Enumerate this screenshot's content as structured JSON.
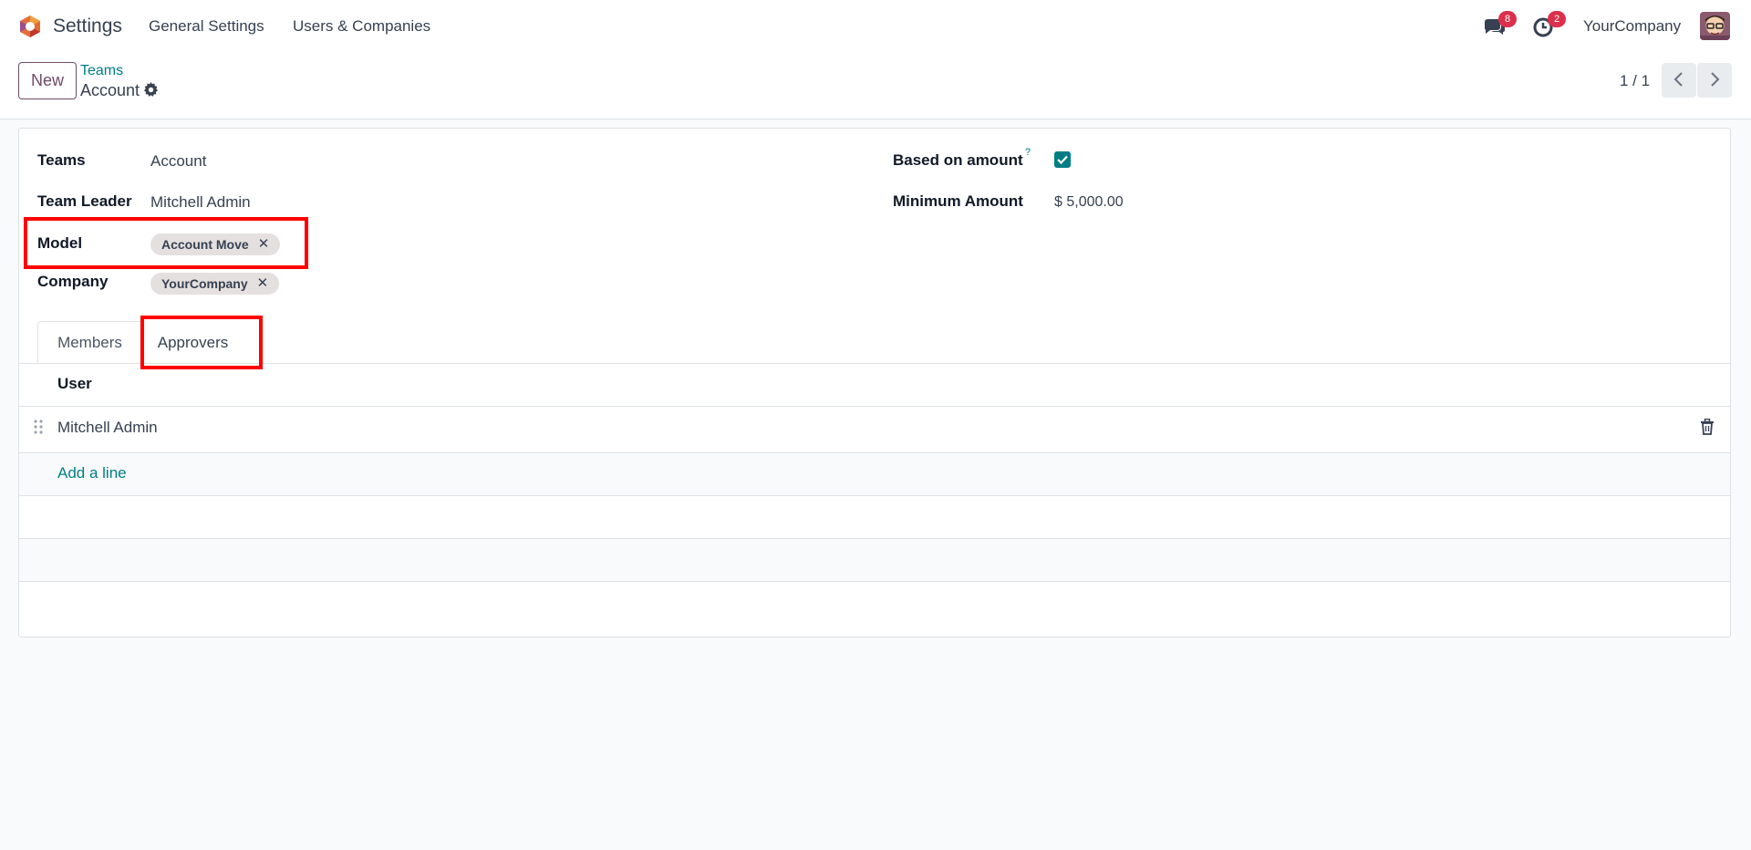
{
  "navbar": {
    "app_name": "Settings",
    "menu": [
      "General Settings",
      "Users & Companies"
    ],
    "chat_count": "8",
    "activity_count": "2",
    "company": "YourCompany",
    "icons": [
      "odoo-logo-icon",
      "chat-icon",
      "clock-icon",
      "avatar"
    ]
  },
  "control": {
    "new_label": "New",
    "breadcrumb_parent": "Teams",
    "breadcrumb_current": "Account",
    "pager": "1 / 1"
  },
  "form": {
    "teams_label": "Teams",
    "teams_value": "Account",
    "leader_label": "Team Leader",
    "leader_value": "Mitchell Admin",
    "model_label": "Model",
    "model_tag": "Account Move",
    "company_label": "Company",
    "company_tag": "YourCompany",
    "based_label": "Based on amount",
    "based_help": "?",
    "based_checked": true,
    "min_label": "Minimum Amount",
    "min_value": "$ 5,000.00"
  },
  "tabs": {
    "members": "Members",
    "approvers": "Approvers"
  },
  "list": {
    "header": "User",
    "rows": [
      "Mitchell Admin"
    ],
    "add_line": "Add a line"
  },
  "colors": {
    "brand": "#714b67",
    "accent": "#017e84",
    "badge": "#dc2f4b",
    "highlight": "#ff0000"
  }
}
